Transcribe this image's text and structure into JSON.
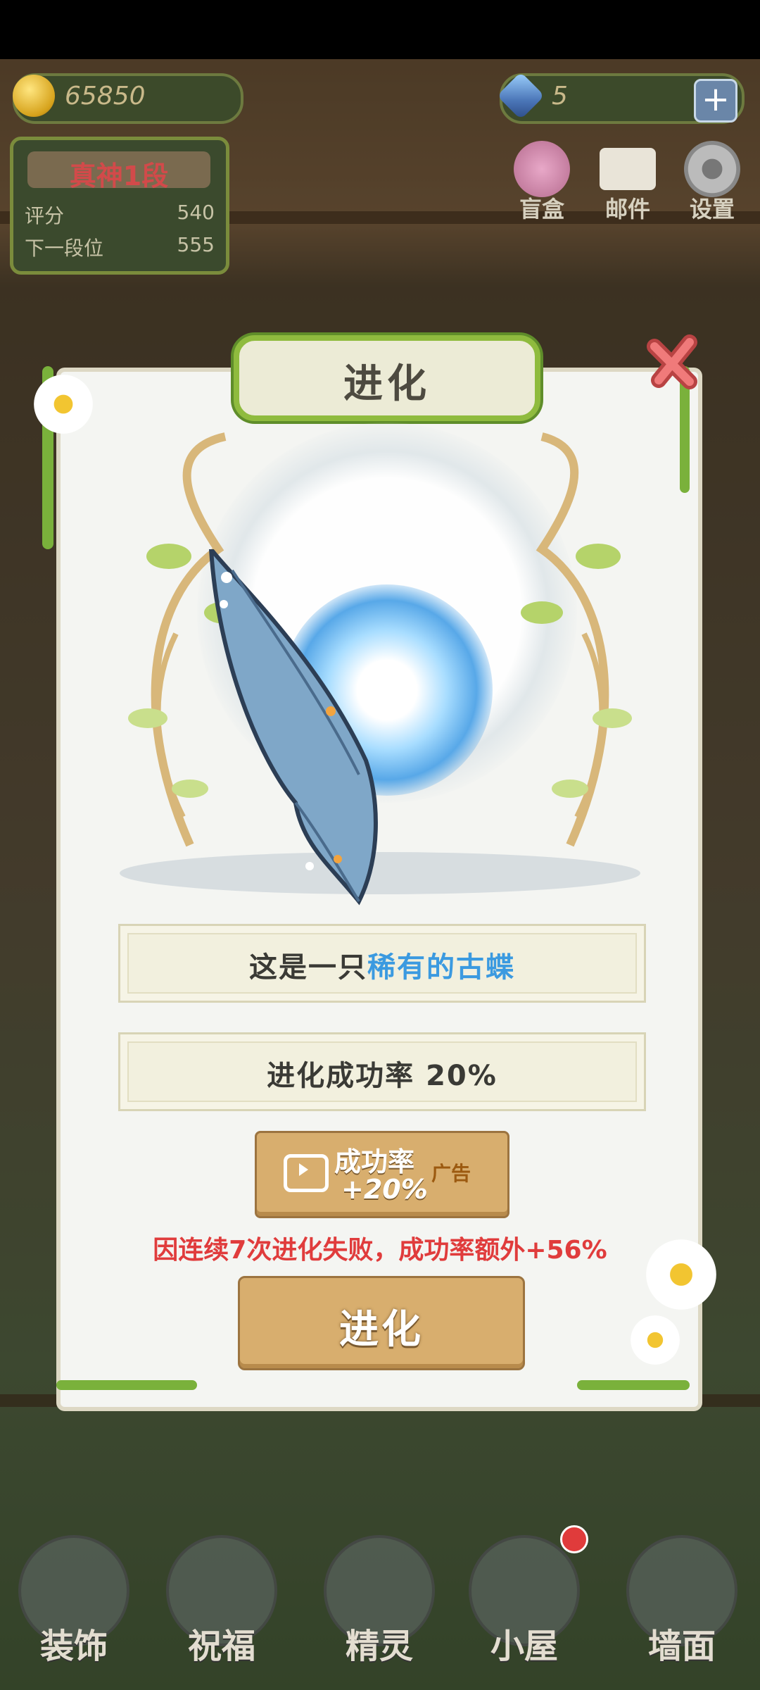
{
  "hud": {
    "gold": "65850",
    "gems": "5",
    "plus_label": "+"
  },
  "rank": {
    "title": "真神1段",
    "score_label": "评分",
    "score_value": "540",
    "next_label": "下一段位",
    "next_value": "555"
  },
  "top_buttons": [
    {
      "label": "盲盒",
      "icon": "blind-box-icon"
    },
    {
      "label": "邮件",
      "icon": "mail-icon"
    },
    {
      "label": "设置",
      "icon": "gear-icon"
    }
  ],
  "dialog": {
    "title": "进化",
    "description_prefix": "这是一只",
    "description_highlight": "稀有的古蝶",
    "success_rate_text": "进化成功率 20%",
    "ad_button": {
      "line1": "成功率",
      "line2": "+20%",
      "tag": "广告"
    },
    "fail_note": "因连续7次进化失败，成功率额外+56%",
    "evolve_button": "进化"
  },
  "bottom_nav": [
    {
      "label": "装饰"
    },
    {
      "label": "祝福"
    },
    {
      "label": "精灵"
    },
    {
      "label": "小屋"
    },
    {
      "label": "墙面"
    }
  ],
  "colors": {
    "accent_green": "#8fbb3e",
    "highlight_blue": "#3b9ae0",
    "warning_red": "#e03c3c",
    "button_wood": "#d8ae6e"
  }
}
